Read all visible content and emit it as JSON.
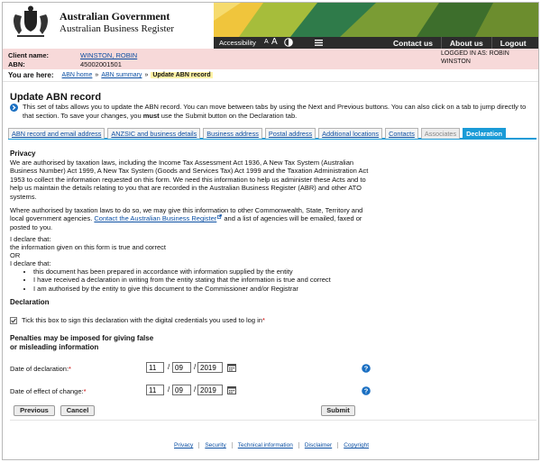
{
  "header": {
    "gov_line1": "Australian Government",
    "gov_line2": "Australian Business Register",
    "accessibility": "Accessibility",
    "text_small": "A",
    "text_large": "A",
    "nav": [
      "Contact us",
      "About us",
      "Logout"
    ]
  },
  "client": {
    "name_label": "Client name:",
    "name_value": "WINSTON, ROBIN",
    "abn_label": "ABN:",
    "abn_value": "45002001501",
    "logged_in": "LOGGED IN AS: ROBIN WINSTON"
  },
  "breadcrumb": {
    "label": "You are here:",
    "items": [
      "ABN home",
      "ABN summary"
    ],
    "separator": "»",
    "current": "Update ABN record"
  },
  "page": {
    "title": "Update ABN record",
    "intro_a": "This set of tabs allows you to update the ABN record. You can move between tabs by using the Next and Previous buttons. You can also click on a tab to jump directly to that section. To save your changes, you ",
    "intro_must": "must",
    "intro_b": " use the Submit button on the Declaration tab."
  },
  "tabs": [
    {
      "label": "ABN record and email address",
      "state": "link"
    },
    {
      "label": "ANZSIC and business details",
      "state": "link"
    },
    {
      "label": "Business address",
      "state": "link"
    },
    {
      "label": "Postal address",
      "state": "link"
    },
    {
      "label": "Additional locations",
      "state": "link"
    },
    {
      "label": "Contacts",
      "state": "link"
    },
    {
      "label": "Associates",
      "state": "disabled"
    },
    {
      "label": "Declaration",
      "state": "active"
    }
  ],
  "privacy": {
    "heading": "Privacy",
    "para1": "We are authorised by taxation laws, including the Income Tax Assessment Act 1936, A New Tax System (Australian Business Number) Act 1999, A New Tax System (Goods and Services Tax) Act 1999 and the Taxation Administration Act 1953 to collect the information requested on this form. We need this information to help us administer these Acts and to help us maintain the details relating to you that are recorded in the Australian Business Register (ABR) and other ATO systems.",
    "para2_a": "Where authorised by taxation laws to do so, we may give this information to other Commonwealth, State, Territory and local government agencies. ",
    "para2_link": "Contact the Australian Business Register",
    "para2_b": " and a list of agencies will be emailed, faxed or posted to you."
  },
  "declare": {
    "intro1": "I declare that:",
    "line1": "the information given on this form is true and correct",
    "or": "OR",
    "intro2": "I declare that:",
    "bullets": [
      "this document has been prepared in accordance with information supplied by the entity",
      "I have received a declaration in writing from the entity stating that the information is true and correct",
      "I am authorised by the entity to give this document to the Commissioner and/or Registrar"
    ]
  },
  "declaration": {
    "heading": "Declaration",
    "checkbox_label": "Tick this box to sign this declaration with the digital credentials you used to log in",
    "required_mark": "*",
    "checked": true
  },
  "penalties": "Penalties may be imposed for giving false or misleading information",
  "dates": {
    "declaration_label": "Date of declaration:",
    "declaration_day": "11",
    "declaration_month": "09",
    "declaration_year": "2019",
    "effect_label": "Date of effect of change:",
    "effect_day": "11",
    "effect_month": "09",
    "effect_year": "2019",
    "separator": "/"
  },
  "buttons": {
    "previous": "Previous",
    "cancel": "Cancel",
    "submit": "Submit"
  },
  "footer": [
    "Privacy",
    "Security",
    "Technical information",
    "Disclaimer",
    "Copyright"
  ],
  "colors": {
    "accent": "#1a9bd7",
    "toolbar": "#2c2c2c",
    "client_bar": "#f7d9d9",
    "link": "#0b4fa3",
    "highlight": "#fff3a6"
  }
}
